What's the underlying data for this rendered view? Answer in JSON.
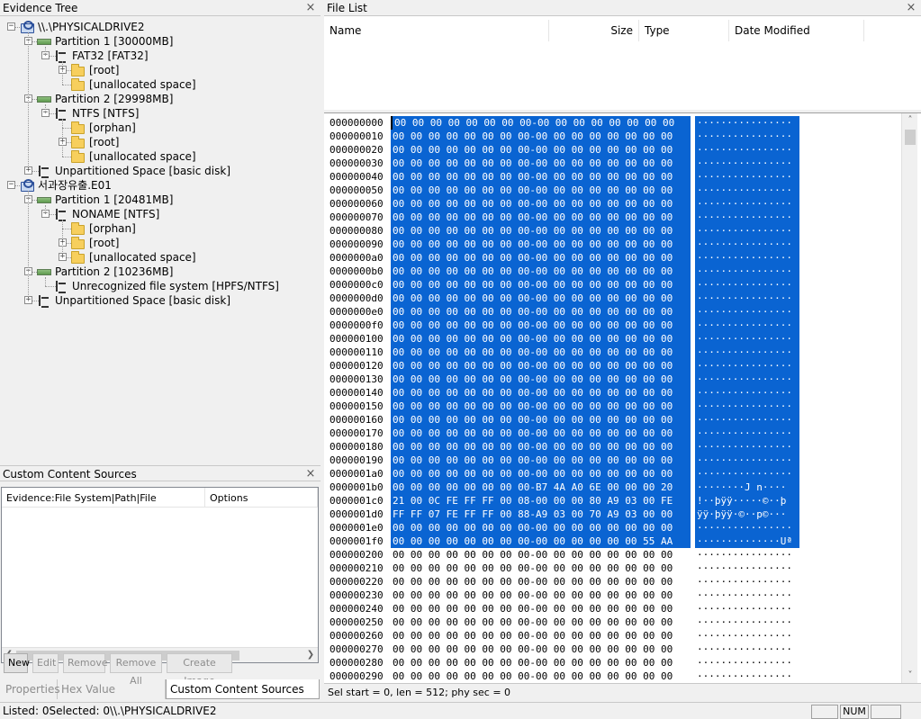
{
  "evidence_tree": {
    "title": "Evidence Tree",
    "nodes": [
      {
        "label": "\\\\.\\PHYSICALDRIVE2",
        "icon": "evidence-icon",
        "level": 0,
        "expander": "-"
      },
      {
        "label": "Partition 1 [30000MB]",
        "icon": "partition-icon",
        "level": 1,
        "expander": "-"
      },
      {
        "label": "FAT32 [FAT32]",
        "icon": "filesystem-icon",
        "level": 2,
        "expander": "-"
      },
      {
        "label": "[root]",
        "icon": "folder-icon",
        "level": 3,
        "expander": "+"
      },
      {
        "label": "[unallocated space]",
        "icon": "folder-icon",
        "level": 3,
        "expander": ""
      },
      {
        "label": "Partition 2 [29998MB]",
        "icon": "partition-icon",
        "level": 1,
        "expander": "-"
      },
      {
        "label": "NTFS [NTFS]",
        "icon": "filesystem-icon",
        "level": 2,
        "expander": "-"
      },
      {
        "label": "[orphan]",
        "icon": "folder-icon",
        "level": 3,
        "expander": ""
      },
      {
        "label": "[root]",
        "icon": "folder-icon",
        "level": 3,
        "expander": "+"
      },
      {
        "label": "[unallocated space]",
        "icon": "folder-icon",
        "level": 3,
        "expander": ""
      },
      {
        "label": "Unpartitioned Space [basic disk]",
        "icon": "filesystem-icon",
        "level": 1,
        "expander": "+"
      },
      {
        "label": "서과장유출.E01",
        "icon": "evidence-icon",
        "level": 0,
        "expander": "-"
      },
      {
        "label": "Partition 1 [20481MB]",
        "icon": "partition-icon",
        "level": 1,
        "expander": "-"
      },
      {
        "label": "NONAME [NTFS]",
        "icon": "filesystem-icon",
        "level": 2,
        "expander": "-"
      },
      {
        "label": "[orphan]",
        "icon": "folder-icon",
        "level": 3,
        "expander": ""
      },
      {
        "label": "[root]",
        "icon": "folder-icon",
        "level": 3,
        "expander": "+"
      },
      {
        "label": "[unallocated space]",
        "icon": "folder-icon",
        "level": 3,
        "expander": "+"
      },
      {
        "label": "Partition 2 [10236MB]",
        "icon": "partition-icon",
        "level": 1,
        "expander": "-"
      },
      {
        "label": "Unrecognized file system [HPFS/NTFS]",
        "icon": "filesystem-icon",
        "level": 2,
        "expander": ""
      },
      {
        "label": "Unpartitioned Space [basic disk]",
        "icon": "filesystem-icon",
        "level": 1,
        "expander": "+"
      }
    ]
  },
  "custom_content": {
    "title": "Custom Content Sources",
    "columns": [
      "Evidence:File System|Path|File",
      "Options"
    ],
    "buttons": [
      {
        "label": "New",
        "enabled": true
      },
      {
        "label": "Edit",
        "enabled": false
      },
      {
        "label": "Remove",
        "enabled": false
      },
      {
        "label": "Remove All",
        "enabled": false
      },
      {
        "label": "Create Image",
        "enabled": false
      }
    ]
  },
  "bottom_tabs": [
    {
      "label": "Properties",
      "active": false
    },
    {
      "label": "Hex Value Interpreter",
      "active": false
    },
    {
      "label": "Custom Content Sources",
      "active": true
    }
  ],
  "file_list": {
    "title": "File List",
    "columns": [
      "Name",
      "Size",
      "Type",
      "Date Modified"
    ]
  },
  "hex_view": {
    "selected_rows": 32,
    "rows": [
      {
        "offset": "000000000",
        "bytes": "00 00 00 00 00 00 00 00-00 00 00 00 00 00 00 00",
        "ascii": "················"
      },
      {
        "offset": "000000010",
        "bytes": "00 00 00 00 00 00 00 00-00 00 00 00 00 00 00 00",
        "ascii": "················"
      },
      {
        "offset": "000000020",
        "bytes": "00 00 00 00 00 00 00 00-00 00 00 00 00 00 00 00",
        "ascii": "················"
      },
      {
        "offset": "000000030",
        "bytes": "00 00 00 00 00 00 00 00-00 00 00 00 00 00 00 00",
        "ascii": "················"
      },
      {
        "offset": "000000040",
        "bytes": "00 00 00 00 00 00 00 00-00 00 00 00 00 00 00 00",
        "ascii": "················"
      },
      {
        "offset": "000000050",
        "bytes": "00 00 00 00 00 00 00 00-00 00 00 00 00 00 00 00",
        "ascii": "················"
      },
      {
        "offset": "000000060",
        "bytes": "00 00 00 00 00 00 00 00-00 00 00 00 00 00 00 00",
        "ascii": "················"
      },
      {
        "offset": "000000070",
        "bytes": "00 00 00 00 00 00 00 00-00 00 00 00 00 00 00 00",
        "ascii": "················"
      },
      {
        "offset": "000000080",
        "bytes": "00 00 00 00 00 00 00 00-00 00 00 00 00 00 00 00",
        "ascii": "················"
      },
      {
        "offset": "000000090",
        "bytes": "00 00 00 00 00 00 00 00-00 00 00 00 00 00 00 00",
        "ascii": "················"
      },
      {
        "offset": "0000000a0",
        "bytes": "00 00 00 00 00 00 00 00-00 00 00 00 00 00 00 00",
        "ascii": "················"
      },
      {
        "offset": "0000000b0",
        "bytes": "00 00 00 00 00 00 00 00-00 00 00 00 00 00 00 00",
        "ascii": "················"
      },
      {
        "offset": "0000000c0",
        "bytes": "00 00 00 00 00 00 00 00-00 00 00 00 00 00 00 00",
        "ascii": "················"
      },
      {
        "offset": "0000000d0",
        "bytes": "00 00 00 00 00 00 00 00-00 00 00 00 00 00 00 00",
        "ascii": "················"
      },
      {
        "offset": "0000000e0",
        "bytes": "00 00 00 00 00 00 00 00-00 00 00 00 00 00 00 00",
        "ascii": "················"
      },
      {
        "offset": "0000000f0",
        "bytes": "00 00 00 00 00 00 00 00-00 00 00 00 00 00 00 00",
        "ascii": "················"
      },
      {
        "offset": "000000100",
        "bytes": "00 00 00 00 00 00 00 00-00 00 00 00 00 00 00 00",
        "ascii": "················"
      },
      {
        "offset": "000000110",
        "bytes": "00 00 00 00 00 00 00 00-00 00 00 00 00 00 00 00",
        "ascii": "················"
      },
      {
        "offset": "000000120",
        "bytes": "00 00 00 00 00 00 00 00-00 00 00 00 00 00 00 00",
        "ascii": "················"
      },
      {
        "offset": "000000130",
        "bytes": "00 00 00 00 00 00 00 00-00 00 00 00 00 00 00 00",
        "ascii": "················"
      },
      {
        "offset": "000000140",
        "bytes": "00 00 00 00 00 00 00 00-00 00 00 00 00 00 00 00",
        "ascii": "················"
      },
      {
        "offset": "000000150",
        "bytes": "00 00 00 00 00 00 00 00-00 00 00 00 00 00 00 00",
        "ascii": "················"
      },
      {
        "offset": "000000160",
        "bytes": "00 00 00 00 00 00 00 00-00 00 00 00 00 00 00 00",
        "ascii": "················"
      },
      {
        "offset": "000000170",
        "bytes": "00 00 00 00 00 00 00 00-00 00 00 00 00 00 00 00",
        "ascii": "················"
      },
      {
        "offset": "000000180",
        "bytes": "00 00 00 00 00 00 00 00-00 00 00 00 00 00 00 00",
        "ascii": "················"
      },
      {
        "offset": "000000190",
        "bytes": "00 00 00 00 00 00 00 00-00 00 00 00 00 00 00 00",
        "ascii": "················"
      },
      {
        "offset": "0000001a0",
        "bytes": "00 00 00 00 00 00 00 00-00 00 00 00 00 00 00 00",
        "ascii": "················"
      },
      {
        "offset": "0000001b0",
        "bytes": "00 00 00 00 00 00 00 00-B7 4A A0 6E 00 00 00 20",
        "ascii": "········J n···· "
      },
      {
        "offset": "0000001c0",
        "bytes": "21 00 0C FE FF FF 00 08-00 00 00 80 A9 03 00 FE",
        "ascii": "!··þÿÿ·····©··þ"
      },
      {
        "offset": "0000001d0",
        "bytes": "FF FF 07 FE FF FF 00 88-A9 03 00 70 A9 03 00 00",
        "ascii": "ÿÿ·þÿÿ·©··p©···"
      },
      {
        "offset": "0000001e0",
        "bytes": "00 00 00 00 00 00 00 00-00 00 00 00 00 00 00 00",
        "ascii": "················"
      },
      {
        "offset": "0000001f0",
        "bytes": "00 00 00 00 00 00 00 00-00 00 00 00 00 00 55 AA",
        "ascii": "··············Uª"
      },
      {
        "offset": "000000200",
        "bytes": "00 00 00 00 00 00 00 00-00 00 00 00 00 00 00 00",
        "ascii": "················"
      },
      {
        "offset": "000000210",
        "bytes": "00 00 00 00 00 00 00 00-00 00 00 00 00 00 00 00",
        "ascii": "················"
      },
      {
        "offset": "000000220",
        "bytes": "00 00 00 00 00 00 00 00-00 00 00 00 00 00 00 00",
        "ascii": "················"
      },
      {
        "offset": "000000230",
        "bytes": "00 00 00 00 00 00 00 00-00 00 00 00 00 00 00 00",
        "ascii": "················"
      },
      {
        "offset": "000000240",
        "bytes": "00 00 00 00 00 00 00 00-00 00 00 00 00 00 00 00",
        "ascii": "················"
      },
      {
        "offset": "000000250",
        "bytes": "00 00 00 00 00 00 00 00-00 00 00 00 00 00 00 00",
        "ascii": "················"
      },
      {
        "offset": "000000260",
        "bytes": "00 00 00 00 00 00 00 00-00 00 00 00 00 00 00 00",
        "ascii": "················"
      },
      {
        "offset": "000000270",
        "bytes": "00 00 00 00 00 00 00 00-00 00 00 00 00 00 00 00",
        "ascii": "················"
      },
      {
        "offset": "000000280",
        "bytes": "00 00 00 00 00 00 00 00-00 00 00 00 00 00 00 00",
        "ascii": "················"
      },
      {
        "offset": "000000290",
        "bytes": "00 00 00 00 00 00 00 00-00 00 00 00 00 00 00 00",
        "ascii": "················"
      }
    ],
    "status": "Sel start = 0, len = 512; phy sec = 0"
  },
  "statusbar": {
    "text": "Listed: 0Selected: 0\\\\.\\PHYSICALDRIVE2",
    "indicators": [
      "",
      "NUM",
      ""
    ]
  },
  "colors": {
    "selection": "#0a64d2"
  }
}
